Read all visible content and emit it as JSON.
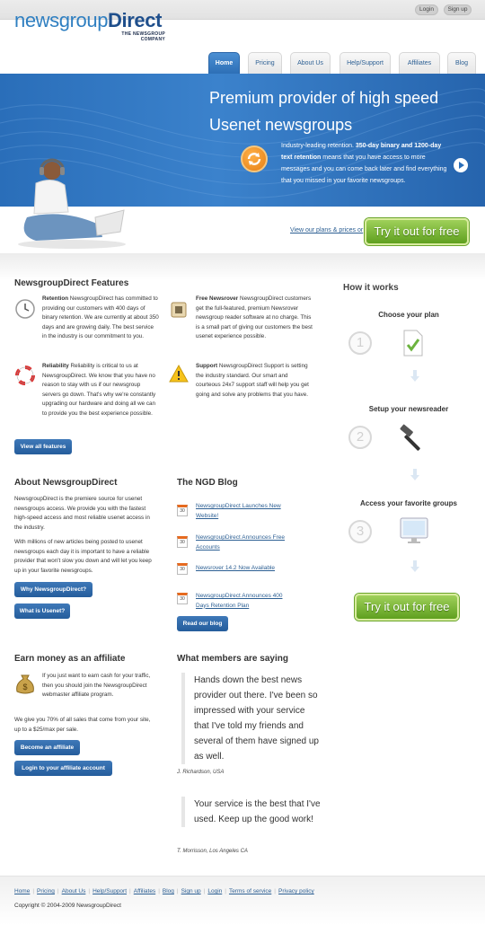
{
  "topbar": {
    "login": "Login",
    "signup": "Sign up"
  },
  "logo": {
    "part1": "newsgroup",
    "part2": "Direct",
    "tagline_line1": "THE NEWSGROUP",
    "tagline_line2": "COMPANY"
  },
  "nav": [
    {
      "label": "Home",
      "active": true
    },
    {
      "label": "Pricing"
    },
    {
      "label": "About Us"
    },
    {
      "label": "Help/Support"
    },
    {
      "label": "Affiliates"
    },
    {
      "label": "Blog"
    }
  ],
  "hero": {
    "title_line1": "Premium provider of high speed",
    "title_line2": "Usenet newsgroups",
    "text_plain1": "Industry-leading retention. ",
    "text_bold": "350-day binary and 1200-day text retention",
    "text_plain2": " means that you have access to more messages and you can come back later and find everything that you missed in your favorite newsgroups."
  },
  "cta": {
    "plans_link": "View our plans & prices or",
    "try_button": "Try it out for free"
  },
  "features": {
    "title": "NewsgroupDirect Features",
    "items": [
      {
        "title": "Retention",
        "text": " NewsgroupDirect has committed to providing our customers with 400 days of binary retention. We are currently at about 350 days and are growing daily. The best service in the industry is our commitment to you.",
        "icon": "clock-icon"
      },
      {
        "title": "Free Newsrover",
        "text": " NewsgroupDirect customers get the full-featured, premium Newsrover newsgroup reader software at no charge. This is a small part of giving our customers the best usenet experience possible.",
        "icon": "software-box-icon"
      },
      {
        "title": "Reliability",
        "text": " Reliability is critical to us at NewsgroupDirect. We know that you have no reason to stay with us if our newsgroup servers go down. That's why we're constantly upgrading our hardware and doing all we can to provide you the best experience possible.",
        "icon": "lifebuoy-icon"
      },
      {
        "title": "Support",
        "text": " NewsgroupDirect Support is setting the industry standard. Our smart and courteous 24x7 support staff will help you get going and solve any problems that you have.",
        "icon": "warning-icon"
      }
    ],
    "view_all": "View all features"
  },
  "how": {
    "title": "How it works",
    "steps": [
      {
        "num": "1",
        "title": "Choose your plan",
        "icon": "document-check-icon"
      },
      {
        "num": "2",
        "title": "Setup your newsreader",
        "icon": "hammer-icon"
      },
      {
        "num": "3",
        "title": "Access your favorite groups",
        "icon": "monitor-icon"
      }
    ]
  },
  "about": {
    "title": "About NewsgroupDirect",
    "p1": "NewsgroupDirect is the premiere source for usenet newsgroups access. We provide you with the fastest high-speed access and most reliable usenet access in the industry.",
    "p2": "With millions of new articles being posted to usenet newsgroups each day it is important to have a reliable provider that won't slow you down and will let you keep up in your favorite newsgroups.",
    "btn1": "Why NewsgroupDirect?",
    "btn2": "What is Usenet?"
  },
  "blog": {
    "title": "The NGD Blog",
    "posts": [
      {
        "title": "NewsgroupDirect Launches New Website!",
        "day": "30"
      },
      {
        "title": "NewsgroupDirect Announces Free Accounts",
        "day": "30"
      },
      {
        "title": "Newsrover 14.2 Now Available",
        "day": "30"
      },
      {
        "title": "NewsgroupDirect Announces 400 Days Retention Plan",
        "day": "30"
      }
    ],
    "read_btn": "Read our blog"
  },
  "affiliate": {
    "title": "Earn money as an affiliate",
    "p1": "If you just want to earn cash for your traffic, then you should join the NewsgroupDirect webmaster affiliate program.",
    "p2": "We give you 70% of all sales that come from your site, up to a $25/max per sale.",
    "btn1": "Become an affiliate",
    "btn2": "Login to your affiliate account"
  },
  "testimonials": {
    "title": "What members are saying",
    "quotes": [
      {
        "text": "Hands down the best news provider out there. I've been so impressed with your service that I've told my friends and several of them have signed up as well.",
        "author": "J. Richardson, USA"
      },
      {
        "text": "Your service is the best that I've used. Keep up the good work!",
        "author": "T. Morrisson, Los Angeles CA"
      }
    ]
  },
  "footer": {
    "links": [
      "Home",
      "Pricing",
      "About Us",
      "Help/Support",
      "Affiliates",
      "Blog",
      "Sign up",
      "Login",
      "Terms of service",
      "Privacy policy"
    ],
    "copyright": "Copyright © 2004-2009 NewsgroupDirect"
  },
  "colors": {
    "brand_blue": "#2f7fc1",
    "cta_green": "#7cba3c",
    "nav_active": "#3a7ec6"
  }
}
